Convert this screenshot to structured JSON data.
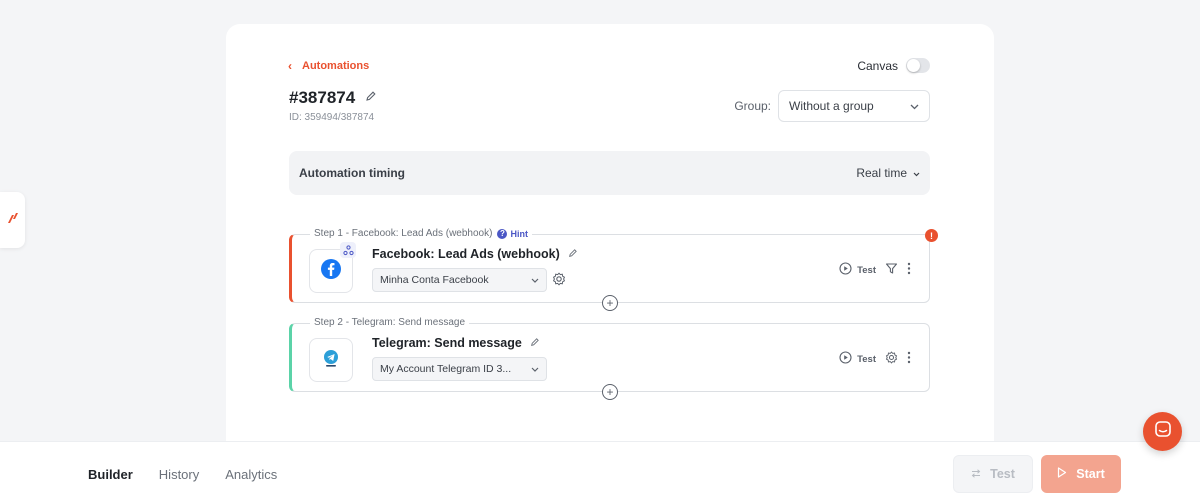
{
  "nav": {
    "back_label": "Automations",
    "canvas_label": "Canvas"
  },
  "automation": {
    "title": "#387874",
    "id_text": "ID: 359494/387874"
  },
  "group": {
    "label": "Group:",
    "value": "Without a group"
  },
  "timing": {
    "label": "Automation timing",
    "value": "Real time"
  },
  "steps": [
    {
      "step_label": "Step 1 - Facebook: Lead Ads (webhook)",
      "hint": "Hint",
      "name": "Facebook: Lead Ads (webhook)",
      "account": "Minha Conta Facebook",
      "test_label": "Test",
      "warning": "!",
      "accent": "#e9512f"
    },
    {
      "step_label": "Step 2 - Telegram: Send message",
      "name": "Telegram: Send message",
      "account": "My Account Telegram ID 3...",
      "test_label": "Test",
      "accent": "#5bd3a8"
    }
  ],
  "bottom": {
    "tabs": [
      "Builder",
      "History",
      "Analytics"
    ],
    "test_button": "Test",
    "start_button": "Start"
  },
  "colors": {
    "brand": "#e9512f",
    "success": "#5bd3a8",
    "hint": "#4b57c5"
  }
}
